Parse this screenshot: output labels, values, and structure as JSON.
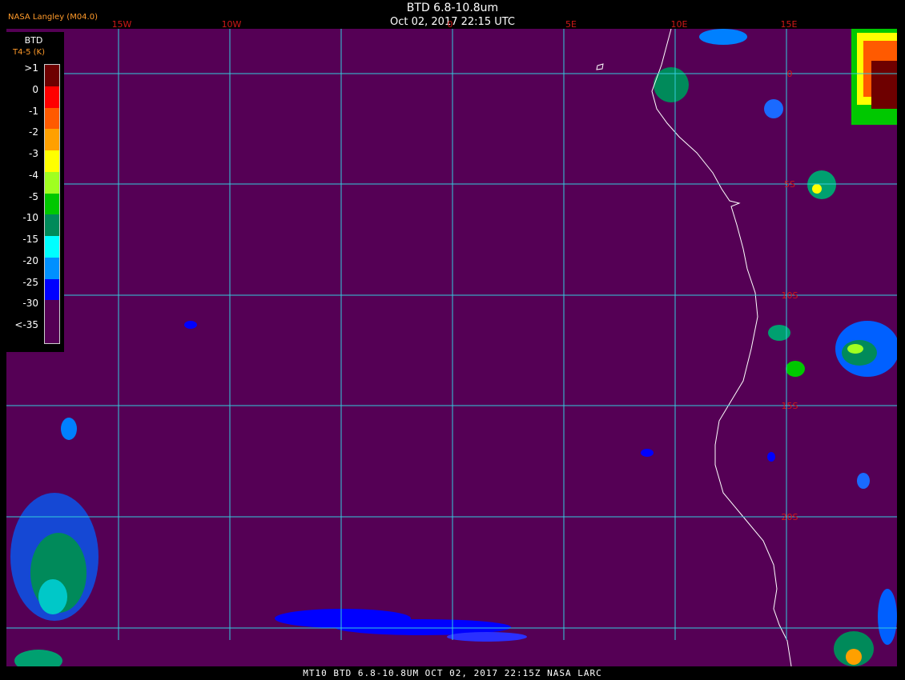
{
  "header": {
    "title": "BTD 6.8-10.8um",
    "timestamp": "Oct 02, 2017 22:15 UTC",
    "brand": "NASA Langley (M04.0)"
  },
  "footer": {
    "caption": "MT10  BTD 6.8-10.8UM  OCT 02, 2017 22:15Z  NASA LARC"
  },
  "legend": {
    "title": "BTD",
    "subtitle": "T4-5 (K)",
    "entries": [
      {
        "label": ">1",
        "color": "#6e0000"
      },
      {
        "label": "0",
        "color": "#ff0000"
      },
      {
        "label": "-1",
        "color": "#ff5a00"
      },
      {
        "label": "-2",
        "color": "#ffa000"
      },
      {
        "label": "-3",
        "color": "#ffff00"
      },
      {
        "label": "-4",
        "color": "#a0ff20"
      },
      {
        "label": "-5",
        "color": "#00c800"
      },
      {
        "label": "-10",
        "color": "#008a5a"
      },
      {
        "label": "-15",
        "color": "#00ffff"
      },
      {
        "label": "-20",
        "color": "#0090ff"
      },
      {
        "label": "-25",
        "color": "#0000ff"
      },
      {
        "label": "-30",
        "color": "#550055"
      },
      {
        "label": "<-35",
        "color": "#550055"
      }
    ]
  },
  "map": {
    "background_color": "#550055",
    "grid_color": "#33ccdd",
    "label_color": "#d01818",
    "coastline_color": "#ffffff",
    "lon_labels": [
      "15W",
      "10W",
      "0",
      "5E",
      "10E",
      "15E"
    ],
    "lat_labels": [
      "0",
      "5S",
      "10S",
      "15S",
      "20S"
    ]
  }
}
